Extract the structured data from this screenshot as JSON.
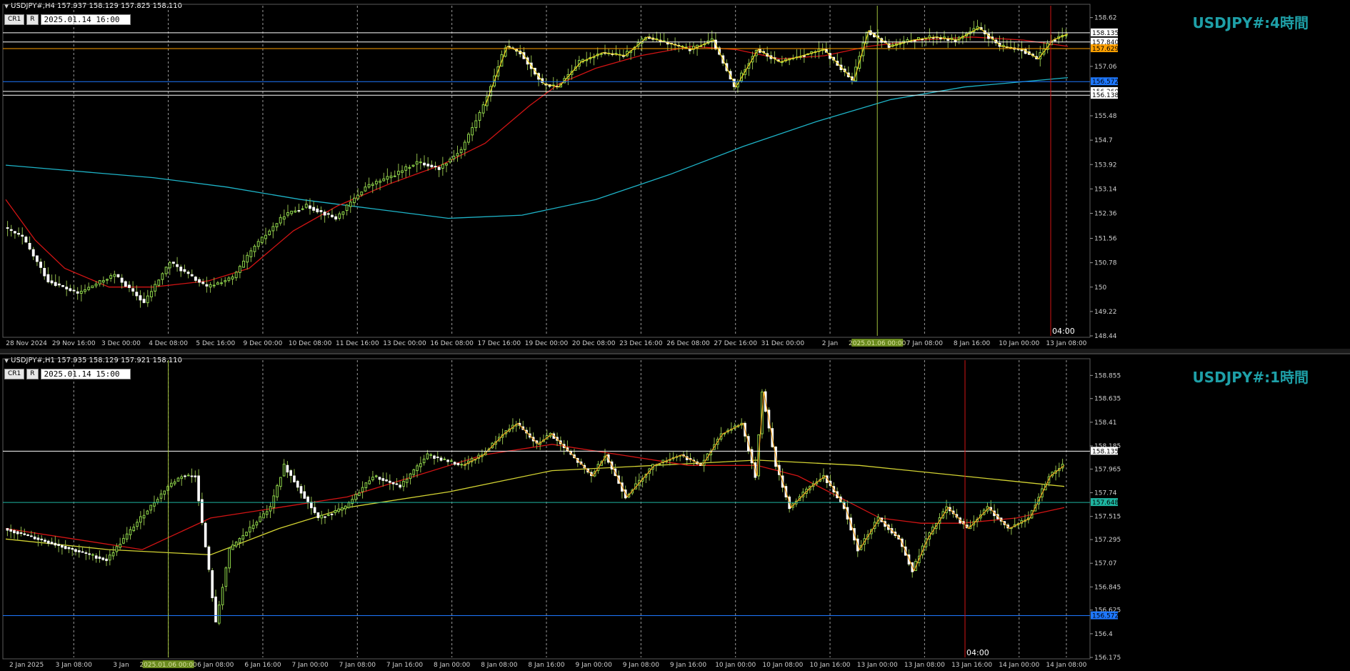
{
  "top": {
    "header": "USDJPY#,H4 157.937 158.129 157.825 158.110",
    "btn_cr1": "CR1",
    "btn_r": "R",
    "date": "2025.01.14 16:00",
    "title": "USDJPY#:4時間",
    "cursor_time": "04:00",
    "colors": {
      "candle_up": "#ffffc8",
      "candle_down": "#ffffff",
      "ma_short": "#d21414",
      "ma_long": "#1eb4c8",
      "zigzag": "#f0d21e"
    }
  },
  "bottom": {
    "header": "USDJPY#,H1 157.935 158.129 157.921 158.110",
    "btn_cr1": "CR1",
    "btn_r": "R",
    "date": "2025.01.14 15:00",
    "title": "USDJPY#:1時間",
    "cursor_time": "04:00",
    "colors": {
      "candle_up": "#ffffc8",
      "candle_down": "#ffffff",
      "ma_short": "#d21414",
      "ma_long": "#d2d232",
      "zigzag": "#f0a01e"
    }
  },
  "chart_data": [
    {
      "type": "candlestick",
      "name": "USDJPY#,H4",
      "ylim": [
        148.44,
        159.0
      ],
      "y_ticks": [
        158.62,
        157.84,
        157.06,
        156.26,
        155.48,
        154.7,
        153.92,
        153.14,
        152.36,
        151.56,
        150.78,
        150.0,
        149.22,
        148.44
      ],
      "x_ticks": [
        "28 Nov 2024",
        "29 Nov 16:00",
        "3 Dec 00:00",
        "4 Dec 08:00",
        "5 Dec 16:00",
        "9 Dec 00:00",
        "10 Dec 08:00",
        "11 Dec 16:00",
        "13 Dec 00:00",
        "16 Dec 08:00",
        "17 Dec 16:00",
        "19 Dec 00:00",
        "20 Dec 08:00",
        "23 Dec 16:00",
        "26 Dec 08:00",
        "27 Dec 16:00",
        "31 Dec 00:00",
        "2 Jan",
        "2025.01.06 00:00",
        "7 Jan 08:00",
        "8 Jan 16:00",
        "10 Jan 00:00",
        "13 Jan 08:00"
      ],
      "highlight_tick": "2025.01.06 00:00",
      "price_levels": [
        {
          "label": "158.135",
          "value": 158.135,
          "color": "#ffffff"
        },
        {
          "label": "157.840",
          "value": 157.84,
          "color": "#ffffff"
        },
        {
          "label": "157.629",
          "value": 157.629,
          "color": "#ffa000"
        },
        {
          "label": "156.572",
          "value": 156.572,
          "color": "#1e78ff"
        },
        {
          "label": "156.260",
          "value": 156.26,
          "color": "#ffffff"
        },
        {
          "label": "156.138",
          "value": 156.138,
          "color": "#ffffff"
        }
      ],
      "path": [
        [
          0,
          151.9
        ],
        [
          5,
          151.6
        ],
        [
          12,
          150.2
        ],
        [
          20,
          149.8
        ],
        [
          30,
          150.4
        ],
        [
          38,
          149.5
        ],
        [
          45,
          150.8
        ],
        [
          55,
          150.0
        ],
        [
          62,
          150.3
        ],
        [
          68,
          151.3
        ],
        [
          76,
          152.3
        ],
        [
          82,
          152.6
        ],
        [
          90,
          152.2
        ],
        [
          98,
          153.2
        ],
        [
          106,
          153.6
        ],
        [
          112,
          154.0
        ],
        [
          118,
          153.8
        ],
        [
          124,
          154.4
        ],
        [
          130,
          155.8
        ],
        [
          136,
          157.7
        ],
        [
          140,
          157.5
        ],
        [
          146,
          156.5
        ],
        [
          150,
          156.4
        ],
        [
          156,
          157.2
        ],
        [
          162,
          157.5
        ],
        [
          168,
          157.4
        ],
        [
          174,
          158.0
        ],
        [
          180,
          157.8
        ],
        [
          186,
          157.6
        ],
        [
          192,
          157.9
        ],
        [
          198,
          156.4
        ],
        [
          204,
          157.6
        ],
        [
          210,
          157.2
        ],
        [
          216,
          157.4
        ],
        [
          222,
          157.6
        ],
        [
          226,
          157.1
        ],
        [
          230,
          156.6
        ],
        [
          234,
          158.2
        ],
        [
          240,
          157.7
        ],
        [
          246,
          157.9
        ],
        [
          252,
          158.0
        ],
        [
          258,
          157.9
        ],
        [
          264,
          158.3
        ],
        [
          270,
          157.7
        ],
        [
          276,
          157.6
        ],
        [
          280,
          157.3
        ],
        [
          284,
          157.9
        ],
        [
          288,
          158.1
        ]
      ],
      "ma_short": [
        [
          0,
          152.8
        ],
        [
          8,
          151.5
        ],
        [
          16,
          150.6
        ],
        [
          28,
          150.0
        ],
        [
          40,
          150.0
        ],
        [
          55,
          150.2
        ],
        [
          66,
          150.6
        ],
        [
          78,
          151.8
        ],
        [
          90,
          152.6
        ],
        [
          104,
          153.3
        ],
        [
          118,
          153.9
        ],
        [
          130,
          154.6
        ],
        [
          142,
          155.8
        ],
        [
          150,
          156.5
        ],
        [
          160,
          157.0
        ],
        [
          172,
          157.4
        ],
        [
          186,
          157.7
        ],
        [
          198,
          157.6
        ],
        [
          210,
          157.3
        ],
        [
          222,
          157.4
        ],
        [
          234,
          157.7
        ],
        [
          248,
          157.9
        ],
        [
          262,
          158.0
        ],
        [
          276,
          157.9
        ],
        [
          288,
          157.7
        ]
      ],
      "ma_long": [
        [
          0,
          153.9
        ],
        [
          20,
          153.7
        ],
        [
          40,
          153.5
        ],
        [
          60,
          153.2
        ],
        [
          80,
          152.8
        ],
        [
          100,
          152.5
        ],
        [
          120,
          152.2
        ],
        [
          140,
          152.3
        ],
        [
          160,
          152.8
        ],
        [
          180,
          153.6
        ],
        [
          200,
          154.5
        ],
        [
          220,
          155.3
        ],
        [
          240,
          156.0
        ],
        [
          260,
          156.4
        ],
        [
          288,
          156.7
        ]
      ]
    },
    {
      "type": "candlestick",
      "name": "USDJPY#,H1",
      "ylim": [
        156.175,
        159.0
      ],
      "y_ticks": [
        158.855,
        158.635,
        158.41,
        158.185,
        157.965,
        157.74,
        157.515,
        157.295,
        157.07,
        156.845,
        156.625,
        156.4,
        156.175
      ],
      "x_ticks": [
        "2 Jan 2025",
        "3 Jan 08:00",
        "3 Jan",
        "2025.01.06 00:00",
        "6 Jan 08:00",
        "6 Jan 16:00",
        "7 Jan 00:00",
        "7 Jan 08:00",
        "7 Jan 16:00",
        "8 Jan 00:00",
        "8 Jan 08:00",
        "8 Jan 16:00",
        "9 Jan 00:00",
        "9 Jan 08:00",
        "9 Jan 16:00",
        "10 Jan 00:00",
        "10 Jan 08:00",
        "10 Jan 16:00",
        "13 Jan 00:00",
        "13 Jan 08:00",
        "13 Jan 16:00",
        "14 Jan 00:00",
        "14 Jan 08:00"
      ],
      "highlight_tick": "2025.01.06 00:00",
      "price_levels": [
        {
          "label": "158.135",
          "value": 158.135,
          "color": "#ffffff"
        },
        {
          "label": "157.648",
          "value": 157.648,
          "color": "#1eb4a0"
        },
        {
          "label": "156.572",
          "value": 156.572,
          "color": "#1e78ff"
        }
      ],
      "path": [
        [
          0,
          157.4
        ],
        [
          10,
          157.3
        ],
        [
          20,
          157.2
        ],
        [
          30,
          157.1
        ],
        [
          40,
          157.5
        ],
        [
          48,
          157.8
        ],
        [
          52,
          157.9
        ],
        [
          56,
          157.9
        ],
        [
          60,
          157.0
        ],
        [
          62,
          156.5
        ],
        [
          66,
          157.2
        ],
        [
          72,
          157.4
        ],
        [
          78,
          157.6
        ],
        [
          82,
          158.0
        ],
        [
          86,
          157.8
        ],
        [
          92,
          157.5
        ],
        [
          100,
          157.6
        ],
        [
          108,
          157.9
        ],
        [
          116,
          157.8
        ],
        [
          124,
          158.1
        ],
        [
          134,
          158.0
        ],
        [
          140,
          158.1
        ],
        [
          146,
          158.3
        ],
        [
          150,
          158.4
        ],
        [
          156,
          158.2
        ],
        [
          160,
          158.3
        ],
        [
          166,
          158.1
        ],
        [
          172,
          157.9
        ],
        [
          176,
          158.1
        ],
        [
          182,
          157.7
        ],
        [
          190,
          158.0
        ],
        [
          198,
          158.1
        ],
        [
          204,
          158.0
        ],
        [
          210,
          158.3
        ],
        [
          216,
          158.4
        ],
        [
          220,
          157.9
        ],
        [
          222,
          158.7
        ],
        [
          226,
          158.0
        ],
        [
          230,
          157.6
        ],
        [
          236,
          157.8
        ],
        [
          240,
          157.9
        ],
        [
          246,
          157.6
        ],
        [
          250,
          157.2
        ],
        [
          256,
          157.5
        ],
        [
          262,
          157.3
        ],
        [
          266,
          157.0
        ],
        [
          270,
          157.3
        ],
        [
          276,
          157.6
        ],
        [
          282,
          157.4
        ],
        [
          288,
          157.6
        ],
        [
          294,
          157.4
        ],
        [
          300,
          157.5
        ],
        [
          306,
          157.9
        ],
        [
          310,
          158.0
        ]
      ],
      "ma_short": [
        [
          0,
          157.4
        ],
        [
          20,
          157.3
        ],
        [
          40,
          157.2
        ],
        [
          60,
          157.5
        ],
        [
          80,
          157.6
        ],
        [
          100,
          157.7
        ],
        [
          120,
          157.9
        ],
        [
          140,
          158.1
        ],
        [
          160,
          158.2
        ],
        [
          180,
          158.1
        ],
        [
          200,
          158.0
        ],
        [
          220,
          158.0
        ],
        [
          232,
          157.9
        ],
        [
          244,
          157.7
        ],
        [
          256,
          157.5
        ],
        [
          268,
          157.45
        ],
        [
          280,
          157.45
        ],
        [
          296,
          157.5
        ],
        [
          310,
          157.6
        ]
      ],
      "ma_long": [
        [
          0,
          157.3
        ],
        [
          30,
          157.2
        ],
        [
          60,
          157.15
        ],
        [
          80,
          157.4
        ],
        [
          100,
          157.6
        ],
        [
          130,
          157.75
        ],
        [
          160,
          157.95
        ],
        [
          190,
          158.0
        ],
        [
          220,
          158.05
        ],
        [
          250,
          158.0
        ],
        [
          280,
          157.9
        ],
        [
          310,
          157.8
        ]
      ]
    }
  ]
}
